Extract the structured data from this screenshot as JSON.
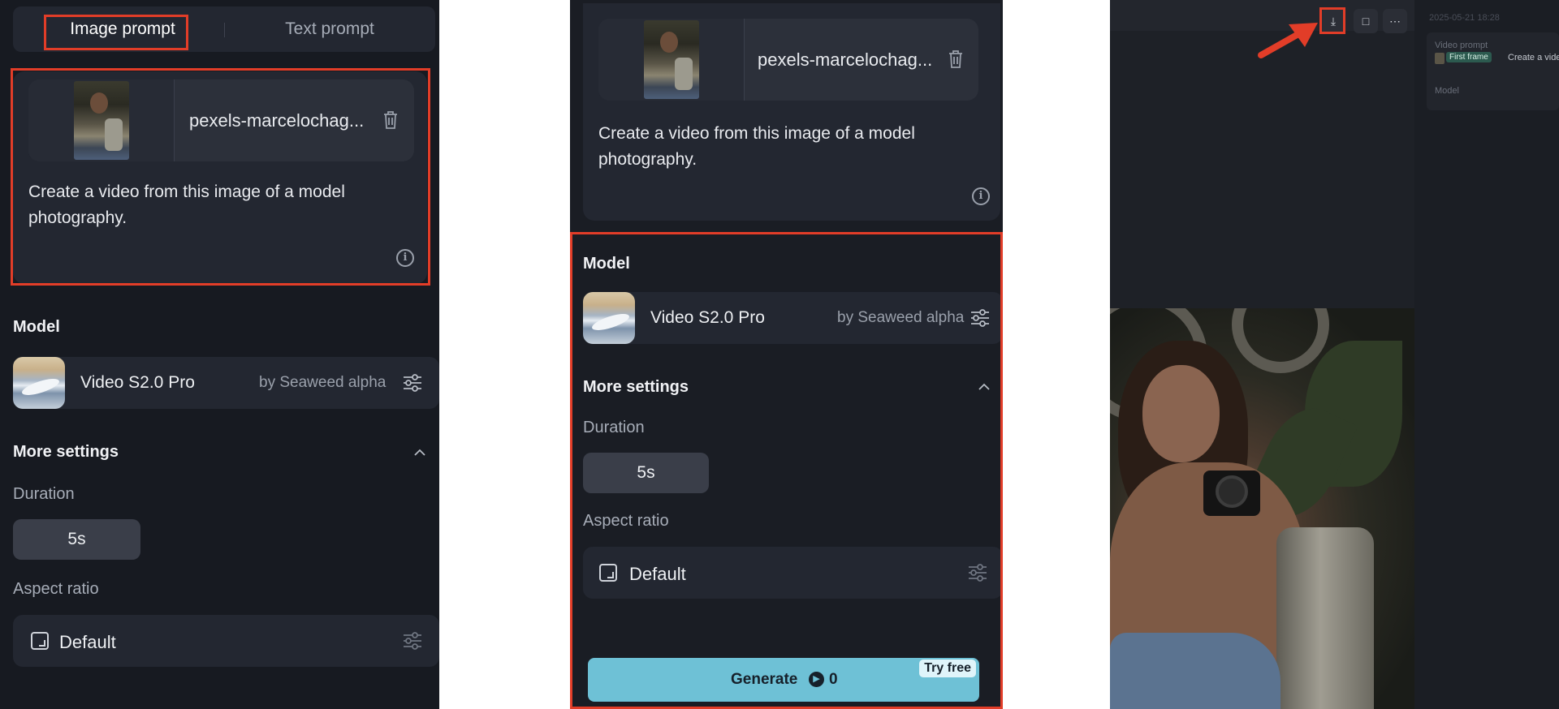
{
  "panel1": {
    "tabs": [
      {
        "label": "Image prompt",
        "active": true
      },
      {
        "label": "Text prompt",
        "active": false
      }
    ],
    "file_name": "pexels-marcelochag...",
    "prompt": "Create a video  from this image of a model photography.",
    "model_heading": "Model",
    "model_name": "Video S2.0 Pro",
    "model_by": "by Seaweed alpha",
    "more_settings": "More settings",
    "duration_label": "Duration",
    "duration_value": "5s",
    "aspect_label": "Aspect ratio",
    "aspect_value": "Default"
  },
  "panel2": {
    "file_name": "pexels-marcelochag...",
    "prompt": "Create a video  from this image of a model photography.",
    "model_heading": "Model",
    "model_name": "Video S2.0 Pro",
    "model_by": "by Seaweed alpha",
    "more_settings": "More settings",
    "duration_label": "Duration",
    "duration_value": "5s",
    "aspect_label": "Aspect ratio",
    "aspect_value": "Default",
    "generate_label": "Generate",
    "generate_cost": "0",
    "try_free": "Try free"
  },
  "panel3": {
    "timestamp": "2025-05-21 18:28",
    "video_prompt_label": "Video prompt",
    "first_frame_tag": "First frame",
    "prompt_snippet": "Create a video",
    "model_label": "Model"
  },
  "colors": {
    "highlight": "#e23d28",
    "generate_bg": "#6ec1d6",
    "try_free_bg": "#dff4fa"
  },
  "icons": [
    "trash-icon",
    "info-icon",
    "sliders-icon",
    "chevron-up-icon",
    "aspect-ratio-icon",
    "download-icon",
    "bookmark-icon",
    "more-icon",
    "credit-icon",
    "arrow-annotation"
  ]
}
